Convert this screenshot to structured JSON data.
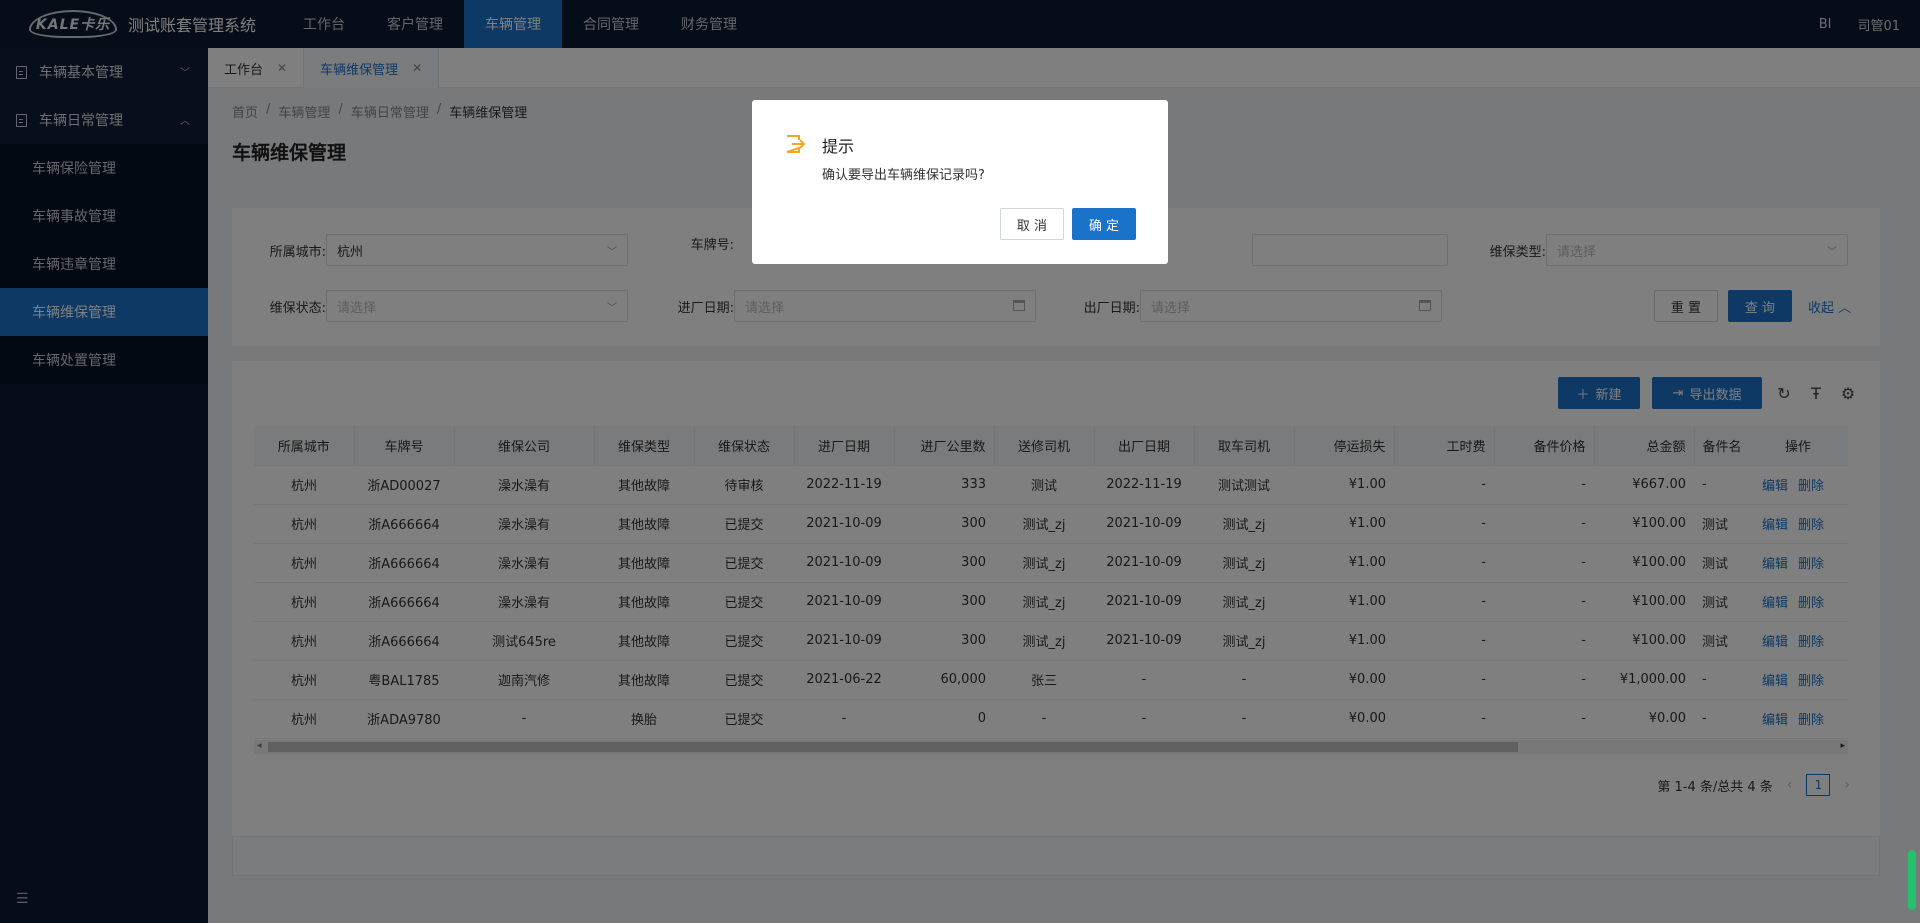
{
  "header": {
    "logo_text": "KALE卡乐",
    "system_title": "测试账套管理系统",
    "nav": [
      "工作台",
      "客户管理",
      "车辆管理",
      "合同管理",
      "财务管理"
    ],
    "active_nav": 2,
    "bi_label": "BI",
    "user": "司管01"
  },
  "sidebar": {
    "group1": "车辆基本管理",
    "group2": "车辆日常管理",
    "items": [
      "车辆保险管理",
      "车辆事故管理",
      "车辆违章管理",
      "车辆维保管理",
      "车辆处置管理"
    ],
    "active_item": 3
  },
  "tabs": [
    {
      "label": "工作台"
    },
    {
      "label": "车辆维保管理"
    }
  ],
  "breadcrumb": [
    "首页",
    "车辆管理",
    "车辆日常管理",
    "车辆维保管理"
  ],
  "page_title": "车辆维保管理",
  "search": {
    "city_label": "所属城市:",
    "city_value": "杭州",
    "plate_label": "车牌号:",
    "type_label": "维保类型:",
    "type_placeholder": "请选择",
    "status_label": "维保状态:",
    "status_placeholder": "请选择",
    "in_date_label": "进厂日期:",
    "in_date_placeholder": "请选择",
    "out_date_label": "出厂日期:",
    "out_date_placeholder": "请选择",
    "reset": "重 置",
    "query": "查 询",
    "collapse": "收起"
  },
  "toolbar": {
    "new": "新建",
    "export": "导出数据"
  },
  "table": {
    "columns": [
      "所属城市",
      "车牌号",
      "维保公司",
      "维保类型",
      "维保状态",
      "进厂日期",
      "进厂公里数",
      "送修司机",
      "出厂日期",
      "取车司机",
      "停运损失",
      "工时费",
      "备件价格",
      "总金额",
      "备件名",
      "操作"
    ],
    "rows": [
      [
        "杭州",
        "浙AD00027",
        "澡水澡有",
        "其他故障",
        "待审核",
        "2022-11-19",
        "333",
        "测试",
        "2022-11-19",
        "测试测试",
        "¥1.00",
        "-",
        "-",
        "¥667.00",
        "-"
      ],
      [
        "杭州",
        "浙A666664",
        "澡水澡有",
        "其他故障",
        "已提交",
        "2021-10-09",
        "300",
        "测试_zj",
        "2021-10-09",
        "测试_zj",
        "¥1.00",
        "-",
        "-",
        "¥100.00",
        "测试"
      ],
      [
        "杭州",
        "浙A666664",
        "澡水澡有",
        "其他故障",
        "已提交",
        "2021-10-09",
        "300",
        "测试_zj",
        "2021-10-09",
        "测试_zj",
        "¥1.00",
        "-",
        "-",
        "¥100.00",
        "测试"
      ],
      [
        "杭州",
        "浙A666664",
        "澡水澡有",
        "其他故障",
        "已提交",
        "2021-10-09",
        "300",
        "测试_zj",
        "2021-10-09",
        "测试_zj",
        "¥1.00",
        "-",
        "-",
        "¥100.00",
        "测试"
      ],
      [
        "杭州",
        "浙A666664",
        "测试645re",
        "其他故障",
        "已提交",
        "2021-10-09",
        "300",
        "测试_zj",
        "2021-10-09",
        "测试_zj",
        "¥1.00",
        "-",
        "-",
        "¥100.00",
        "测试"
      ],
      [
        "杭州",
        "粤BAL1785",
        "迦南汽修",
        "其他故障",
        "已提交",
        "2021-06-22",
        "60,000",
        "张三",
        "-",
        "-",
        "¥0.00",
        "-",
        "-",
        "¥1,000.00",
        "-"
      ],
      [
        "杭州",
        "浙ADA9780",
        "-",
        "换胎",
        "已提交",
        "-",
        "0",
        "-",
        "-",
        "-",
        "¥0.00",
        "-",
        "-",
        "¥0.00",
        "-"
      ]
    ],
    "edit": "编辑",
    "delete": "删除"
  },
  "pager": {
    "summary": "第 1-4 条/总共 4 条",
    "current": "1"
  },
  "dialog": {
    "title": "提示",
    "message": "确认要导出车辆维保记录吗?",
    "cancel": "取 消",
    "confirm": "确 定"
  },
  "colors": {
    "accent": "#1b73c9",
    "dark_bg": "#0b1a30",
    "warning": "#f5a623"
  }
}
